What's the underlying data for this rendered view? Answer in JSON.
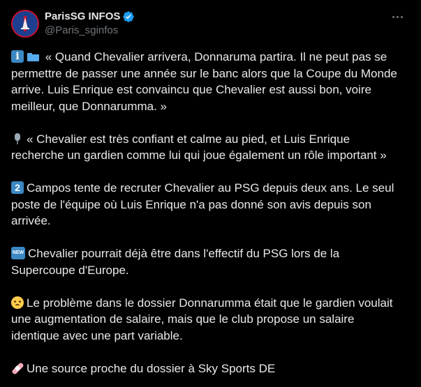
{
  "account": {
    "display_name": "ParisSG INFOS",
    "handle": "@Paris_sginfos",
    "verified_color": "#1d9bf0"
  },
  "colors": {
    "background": "#000000",
    "text": "#e7e9ea",
    "secondary_text": "#71767b"
  },
  "tweet": {
    "paragraphs": [
      {
        "emoji": [
          "info-emoji",
          "folder-emoji"
        ],
        "text": " « Quand Chevalier arrivera, Donnaruma partira. Il ne peut pas se permettre de passer une année sur le banc alors que la Coupe du Monde arrive. Luis Enrique est convaincu que Chevalier est aussi bon, voire meilleur, que Donnarumma. »"
      },
      {
        "emoji": [
          "microphone-emoji"
        ],
        "text": "« Chevalier est très confiant et calme au pied, et Luis Enrique recherche un gardien comme lui qui joue également un rôle important »"
      },
      {
        "emoji": [
          "keycap-two-emoji"
        ],
        "text": "Campos tente de recruter Chevalier au PSG depuis deux ans. Le seul poste de l'équipe où Luis Enrique n'a pas donné son avis depuis son arrivée."
      },
      {
        "emoji": [
          "new-button-emoji"
        ],
        "text": "Chevalier pourrait déjà être dans l'effectif du PSG lors de la Supercoupe d'Europe."
      },
      {
        "emoji": [
          "worried-face-emoji"
        ],
        "text": "Le problème dans le dossier Donnarumma était que le gardien voulait une augmentation de salaire, mais que le club propose un salaire identique avec une part variable."
      },
      {
        "emoji": [
          "adhesive-bandage-emoji"
        ],
        "text": "Une source proche du dossier à Sky Sports DE",
        "trailing_emoji": "germany-flag-emoji"
      }
    ]
  }
}
